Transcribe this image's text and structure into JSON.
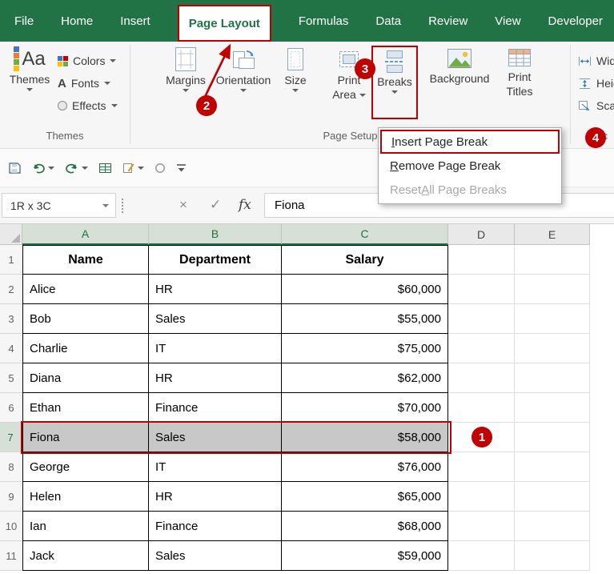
{
  "active_tab_index": 3,
  "ribbon_tabs": [
    "File",
    "Home",
    "Insert",
    "Page Layout",
    "Formulas",
    "Data",
    "Review",
    "View",
    "Developer"
  ],
  "ribbon": {
    "themes_group": {
      "label": "Themes",
      "icon_text": "Aa",
      "themes": "Themes",
      "colors": "Colors",
      "fonts": "Fonts",
      "fonts_icon_letter": "A",
      "effects": "Effects"
    },
    "page_setup_group": {
      "label": "Page Setup",
      "margins": "Margins",
      "orientation": "Orientation",
      "size": "Size",
      "print_area_line1": "Print",
      "print_area_line2": "Area",
      "breaks": "Breaks",
      "background": "Background",
      "print_titles_line1": "Print",
      "print_titles_line2": "Titles"
    },
    "scale_group": {
      "label": "Sc",
      "width": "Widt",
      "height": "Heig",
      "scale": "Scale"
    }
  },
  "breaks_menu": {
    "items": [
      {
        "pre": "",
        "key": "I",
        "rest": "nsert Page Break",
        "disabled": false
      },
      {
        "pre": "",
        "key": "R",
        "rest": "emove Page Break",
        "disabled": false
      },
      {
        "pre": "Reset ",
        "key": "A",
        "rest": "ll Page Breaks",
        "disabled": true
      }
    ]
  },
  "name_box": {
    "value": "1R x 3C"
  },
  "formula_bar": {
    "cancel_label": "×",
    "enter_label": "✓",
    "fx_label": "fx",
    "value": "Fiona"
  },
  "grid": {
    "column_headers": [
      "A",
      "B",
      "C",
      "D",
      "E"
    ],
    "selected_columns": [
      "A",
      "B",
      "C"
    ],
    "row_numbers": [
      "1",
      "2",
      "3",
      "4",
      "5",
      "6",
      "7",
      "8",
      "9",
      "10",
      "11"
    ],
    "selected_sheet_row": 7,
    "selected_row_index": 5,
    "table_headers": [
      "Name",
      "Department",
      "Salary"
    ],
    "rows": [
      {
        "name": "Alice",
        "department": "HR",
        "salary": "$60,000"
      },
      {
        "name": "Bob",
        "department": "Sales",
        "salary": "$55,000"
      },
      {
        "name": "Charlie",
        "department": "IT",
        "salary": "$75,000"
      },
      {
        "name": "Diana",
        "department": "HR",
        "salary": "$62,000"
      },
      {
        "name": "Ethan",
        "department": "Finance",
        "salary": "$70,000"
      },
      {
        "name": "Fiona",
        "department": "Sales",
        "salary": "$58,000"
      },
      {
        "name": "George",
        "department": "IT",
        "salary": "$76,000"
      },
      {
        "name": "Helen",
        "department": "HR",
        "salary": "$65,000"
      },
      {
        "name": "Ian",
        "department": "Finance",
        "salary": "$68,000"
      },
      {
        "name": "Jack",
        "department": "Sales",
        "salary": "$59,000"
      }
    ]
  },
  "annotations": {
    "step1": "1",
    "step2": "2",
    "step3": "3",
    "step4": "4"
  },
  "colors": {
    "excel_green": "#217346",
    "annotation_red": "#c00000",
    "selection_gray": "#c8c8c8"
  },
  "icons": [
    "save-icon",
    "undo-icon",
    "redo-icon",
    "sheet-grid-icon",
    "edit-mode-icon",
    "status-circle-icon",
    "customize-qat-icon",
    "select-all-triangle",
    "themes-icon",
    "colors-icon",
    "fonts-icon",
    "effects-icon",
    "margins-icon",
    "orientation-icon",
    "size-icon",
    "print-area-icon",
    "breaks-icon",
    "background-icon",
    "print-titles-icon",
    "width-icon",
    "height-icon",
    "scale-icon"
  ]
}
